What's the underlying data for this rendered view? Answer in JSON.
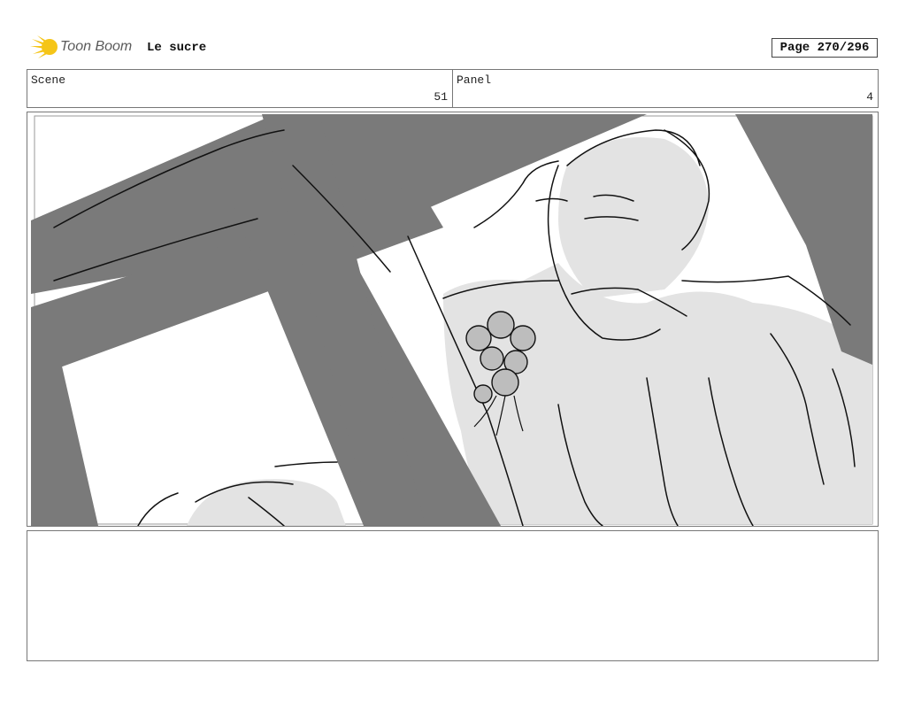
{
  "header": {
    "brand": "Toon Boom",
    "brand_icon": "comet-logo-icon",
    "project_title": "Le sucre",
    "page_label": "Page 270/296"
  },
  "scene": {
    "label": "Scene",
    "value": "51"
  },
  "panel": {
    "label": "Panel",
    "value": "4"
  },
  "colors": {
    "beam_gray": "#7a7a7a",
    "figure_gray": "#e3e3e3",
    "logo_yellow": "#f5c518",
    "line": "#111111"
  },
  "notes": {
    "text": ""
  }
}
